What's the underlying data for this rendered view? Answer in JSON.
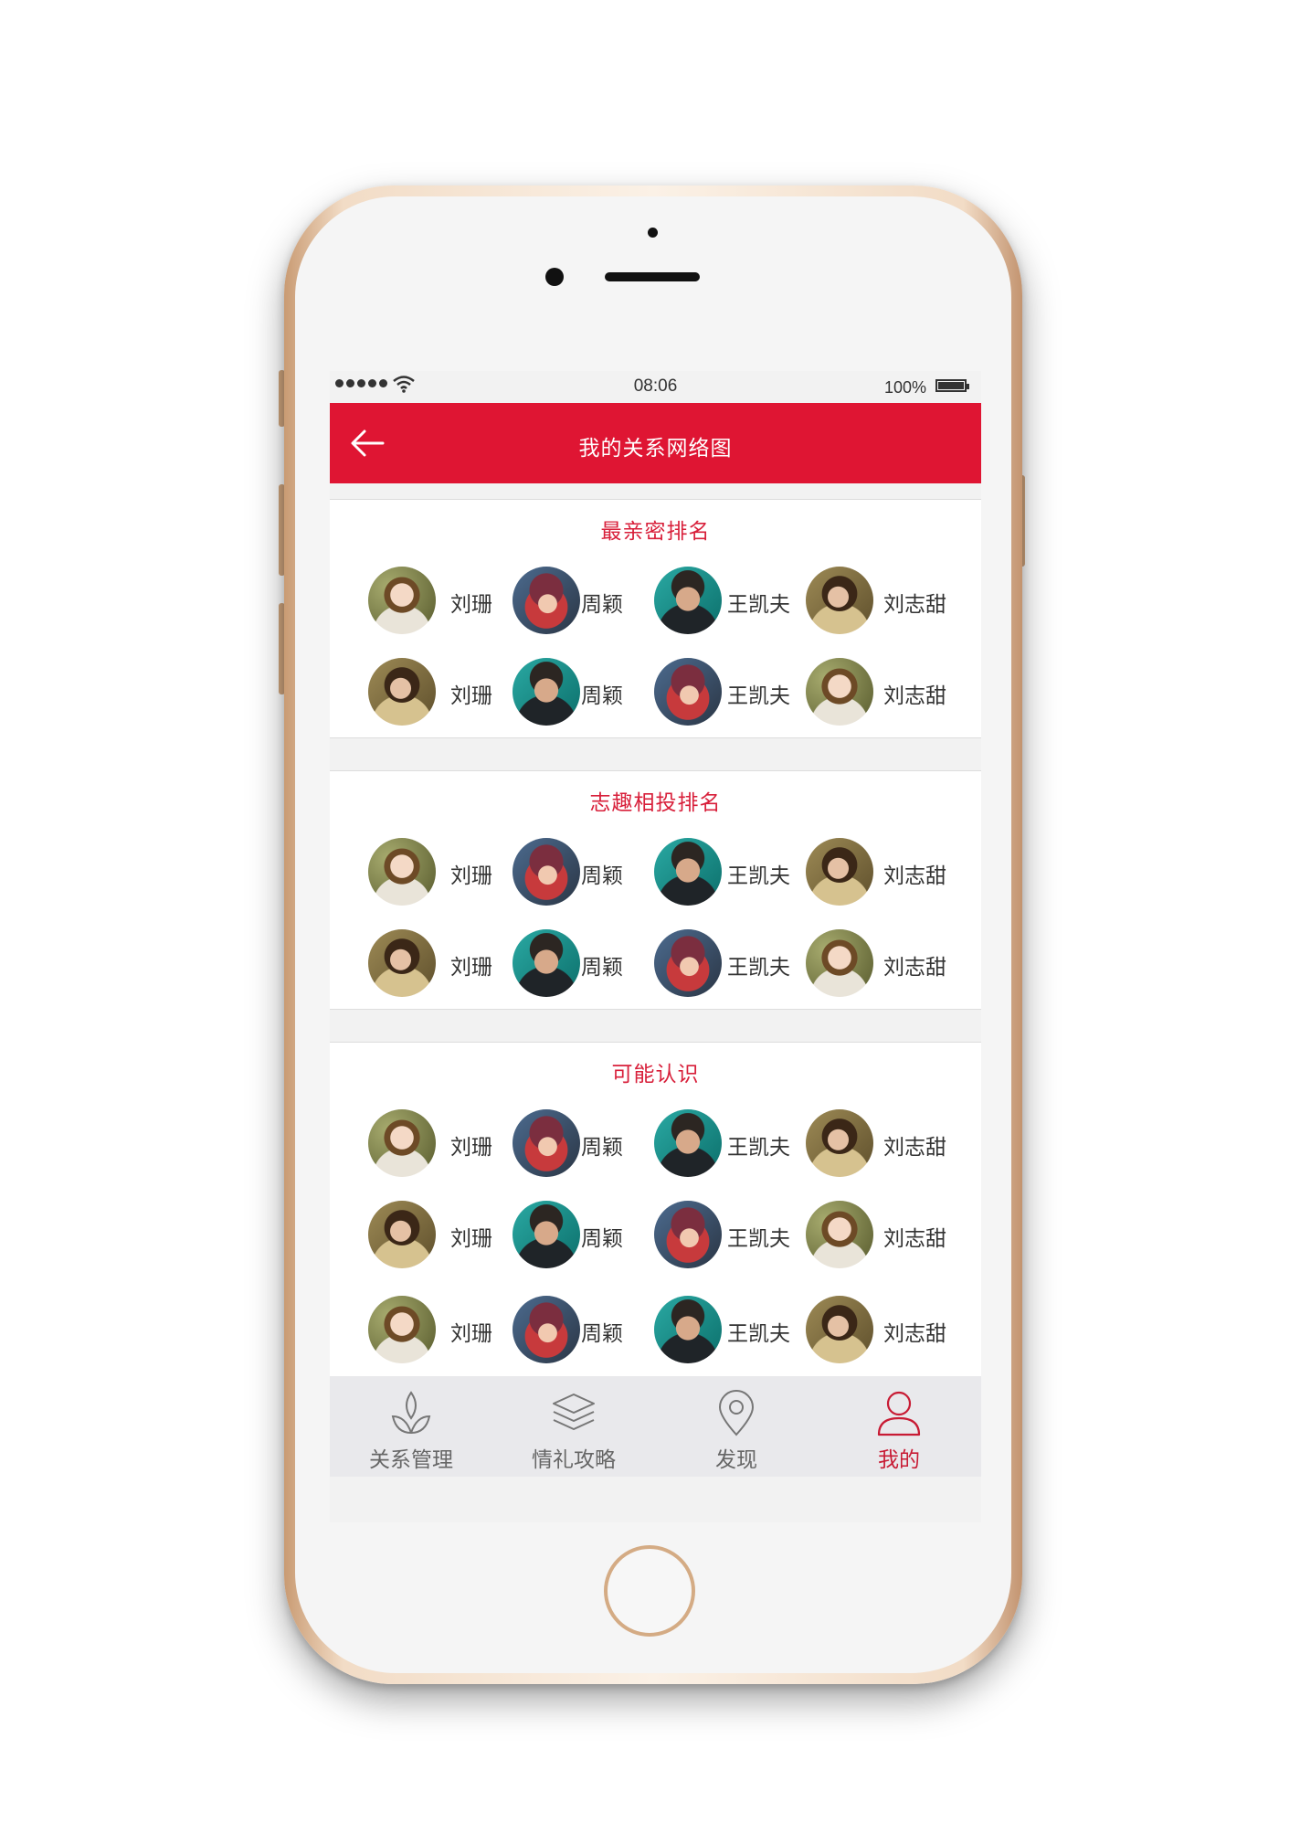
{
  "status_bar": {
    "time": "08:06",
    "battery": "100%"
  },
  "header": {
    "title": "我的关系网络图"
  },
  "sections": [
    {
      "title": "最亲密排名",
      "rows": [
        [
          {
            "name": "刘珊",
            "avatar": "a"
          },
          {
            "name": "周颖",
            "avatar": "b"
          },
          {
            "name": "王凯夫",
            "avatar": "c"
          },
          {
            "name": "刘志甜",
            "avatar": "d"
          }
        ],
        [
          {
            "name": "刘珊",
            "avatar": "d"
          },
          {
            "name": "周颖",
            "avatar": "c"
          },
          {
            "name": "王凯夫",
            "avatar": "b"
          },
          {
            "name": "刘志甜",
            "avatar": "a"
          }
        ]
      ]
    },
    {
      "title": "志趣相投排名",
      "rows": [
        [
          {
            "name": "刘珊",
            "avatar": "a"
          },
          {
            "name": "周颖",
            "avatar": "b"
          },
          {
            "name": "王凯夫",
            "avatar": "c"
          },
          {
            "name": "刘志甜",
            "avatar": "d"
          }
        ],
        [
          {
            "name": "刘珊",
            "avatar": "d"
          },
          {
            "name": "周颖",
            "avatar": "c"
          },
          {
            "name": "王凯夫",
            "avatar": "b"
          },
          {
            "name": "刘志甜",
            "avatar": "a"
          }
        ]
      ]
    },
    {
      "title": "可能认识",
      "rows": [
        [
          {
            "name": "刘珊",
            "avatar": "a"
          },
          {
            "name": "周颖",
            "avatar": "b"
          },
          {
            "name": "王凯夫",
            "avatar": "c"
          },
          {
            "name": "刘志甜",
            "avatar": "d"
          }
        ],
        [
          {
            "name": "刘珊",
            "avatar": "d"
          },
          {
            "name": "周颖",
            "avatar": "c"
          },
          {
            "name": "王凯夫",
            "avatar": "b"
          },
          {
            "name": "刘志甜",
            "avatar": "a"
          }
        ],
        [
          {
            "name": "刘珊",
            "avatar": "a"
          },
          {
            "name": "周颖",
            "avatar": "b"
          },
          {
            "name": "王凯夫",
            "avatar": "c"
          },
          {
            "name": "刘志甜",
            "avatar": "d"
          }
        ]
      ]
    }
  ],
  "tabs": [
    {
      "label": "关系管理",
      "icon": "leaf-icon",
      "active": false
    },
    {
      "label": "情礼攻略",
      "icon": "layers-icon",
      "active": false
    },
    {
      "label": "发现",
      "icon": "location-pin-icon",
      "active": false
    },
    {
      "label": "我的",
      "icon": "user-icon",
      "active": true
    }
  ],
  "colors": {
    "accent": "#df1533",
    "section_title": "#d81f3a",
    "active_tab": "#c81b34"
  }
}
